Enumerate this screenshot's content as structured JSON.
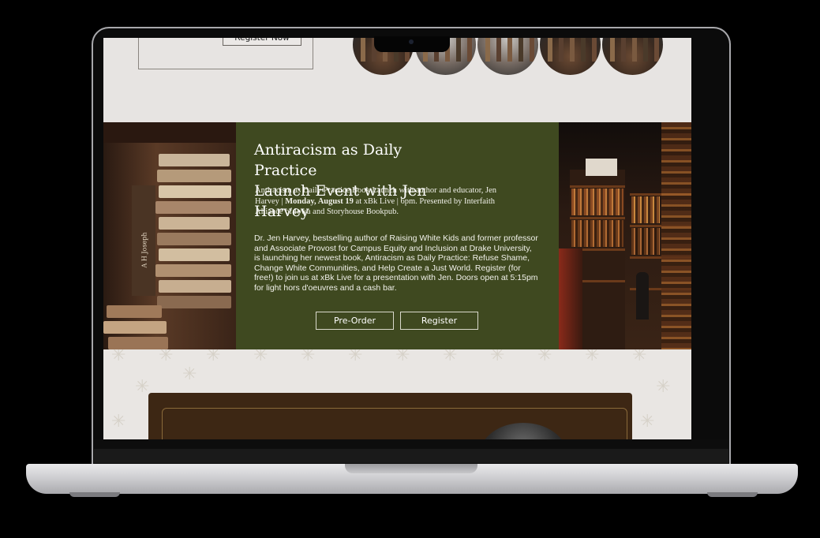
{
  "top": {
    "register_label": "Register Now"
  },
  "feature": {
    "title_line1": "Antiracism as Daily Practice",
    "title_line2": "Launch Event with Jen Harvey",
    "intro_part1": "Antiracism as Daily Practice Book Launch with author and educator, Jen Harvey | ",
    "intro_bold": "Monday, August 19",
    "intro_part2": " at xBk Live | 6pm. Presented by Interfaith Alliance of Iowa and Storyhouse Bookpub.",
    "body": "Dr. Jen Harvey, bestselling author of Raising White Kids and former professor and Associate Provost for Campus Equity and Inclusion at Drake University, is launching her newest book, Antiracism as Daily Practice: Refuse Shame, Change White Communities, and Help Create a Just World. Register (for free!) to join us at xBk Live for a presentation with Jen. Doors open at 5:15pm for light hors d'oeuvres and a cash bar.",
    "preorder_label": "Pre-Order",
    "register_label": "Register",
    "book_spine_text": "A H Joseph"
  },
  "colors": {
    "feature_bg": "#3f4920",
    "page_bg": "#e7e4e2",
    "dark_card": "#3d2714"
  }
}
